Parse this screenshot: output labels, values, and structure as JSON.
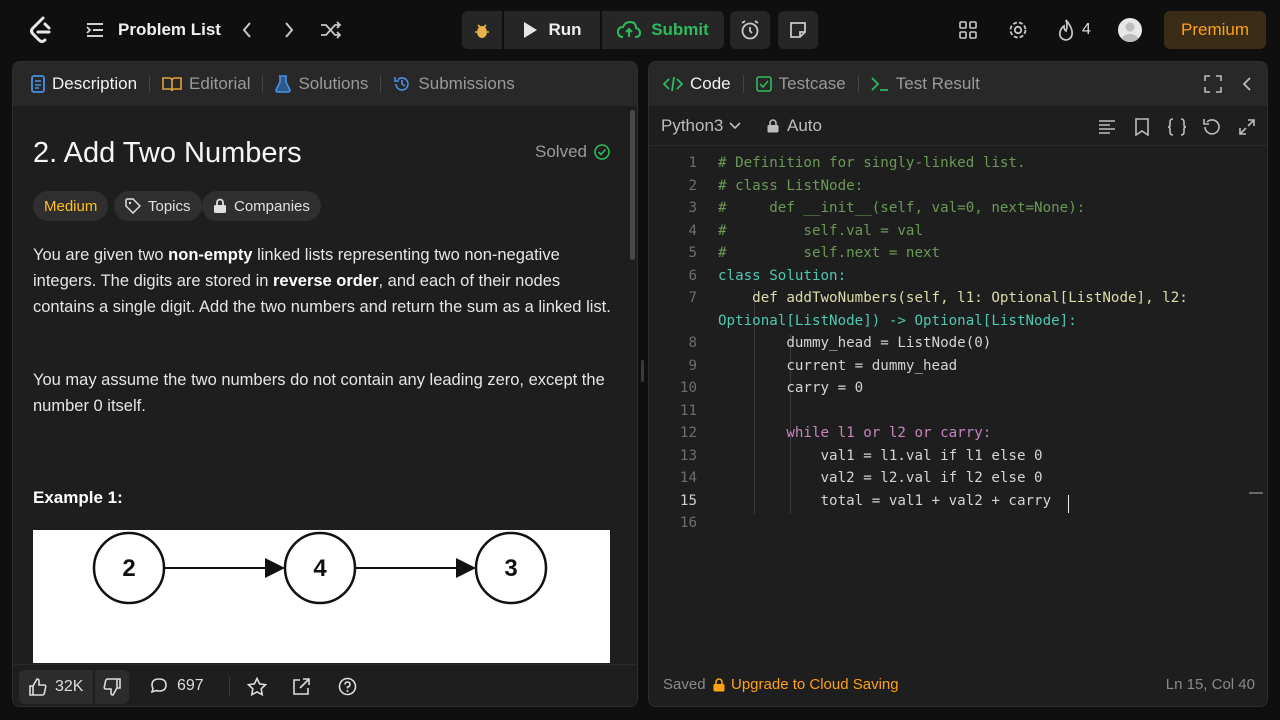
{
  "topbar": {
    "logo": "leetcode-logo",
    "problem_list_label": "Problem List",
    "run_label": "Run",
    "submit_label": "Submit",
    "streak_count": "4",
    "premium_label": "Premium"
  },
  "left": {
    "tabs": [
      "Description",
      "Editorial",
      "Solutions",
      "Submissions"
    ],
    "title": "2. Add Two Numbers",
    "solved_label": "Solved",
    "pills": [
      "Medium",
      "Topics",
      "Companies"
    ],
    "para1_parts": [
      "You are given two ",
      "non-empty",
      " linked lists representing two non-negative integers. The digits are stored in ",
      "reverse order",
      ", and each of their nodes contains a single digit. Add the two numbers and return the sum as a linked list."
    ],
    "para2": "You may assume the two numbers do not contain any leading zero, except the number 0 itself.",
    "example_title": "Example 1:",
    "diagram_nodes": [
      "2",
      "4",
      "3"
    ],
    "likes": "32K",
    "comments": "697"
  },
  "right": {
    "tabs": [
      "Code",
      "Testcase",
      "Test Result"
    ],
    "language": "Python3",
    "auto_label": "Auto",
    "saved_label": "Saved",
    "upgrade_label": "Upgrade to Cloud Saving",
    "cursor_pos": "Ln 15, Col 40",
    "line_numbers": [
      "1",
      "2",
      "3",
      "4",
      "5",
      "6",
      "7",
      "",
      "8",
      "9",
      "10",
      "11",
      "12",
      "13",
      "14",
      "15",
      "16"
    ],
    "code_lines": [
      "# Definition for singly-linked list.",
      "# class ListNode:",
      "#     def __init__(self, val=0, next=None):",
      "#         self.val = val",
      "#         self.next = next",
      "class Solution:",
      "    def addTwoNumbers(self, l1: Optional[ListNode], l2:",
      "Optional[ListNode]) -> Optional[ListNode]:",
      "        dummy_head = ListNode(0)",
      "        current = dummy_head",
      "        carry = 0",
      "",
      "        while l1 or l2 or carry:",
      "            val1 = l1.val if l1 else 0",
      "            val2 = l2.val if l2 else 0",
      "            total = val1 + val2 + carry",
      ""
    ]
  },
  "colors": {
    "accent_orange": "#ffa116",
    "submit_green": "#2cbb5d",
    "medium_yellow": "#ffc01e"
  }
}
